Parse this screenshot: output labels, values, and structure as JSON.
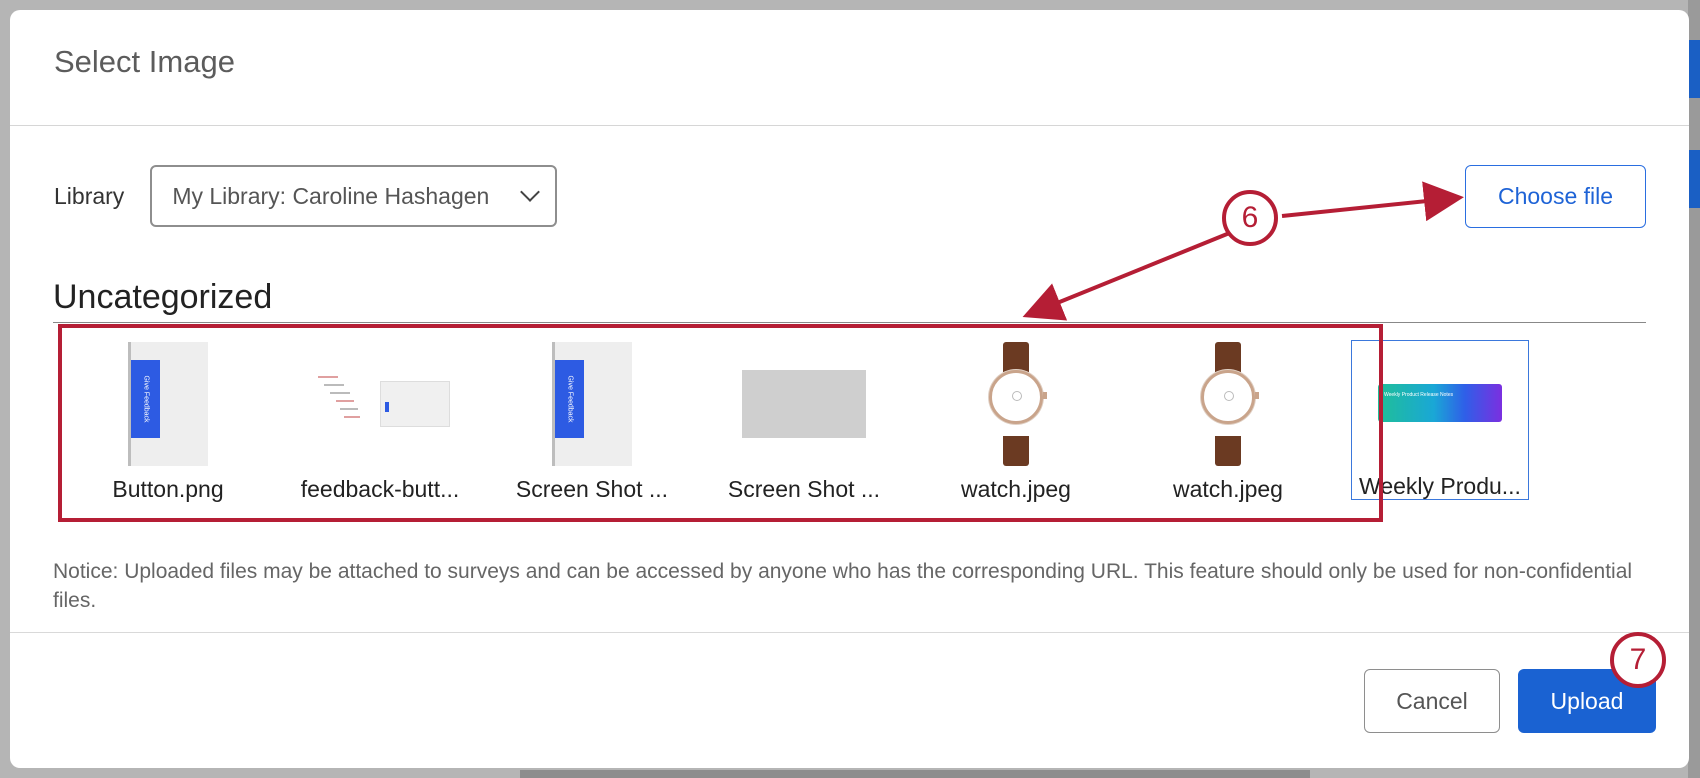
{
  "dialog": {
    "title": "Select Image"
  },
  "library": {
    "label": "Library",
    "selected": "My Library: Caroline Hashagen"
  },
  "choose_file_label": "Choose file",
  "section": {
    "title": "Uncategorized"
  },
  "files": [
    {
      "name": "Button.png",
      "thumb": "feedback-tab-icon"
    },
    {
      "name": "feedback-butt...",
      "thumb": "screenshot-icon"
    },
    {
      "name": "Screen Shot ...",
      "thumb": "feedback-tab-icon"
    },
    {
      "name": "Screen Shot ...",
      "thumb": "gray-placeholder-icon"
    },
    {
      "name": "watch.jpeg",
      "thumb": "watch-icon"
    },
    {
      "name": "watch.jpeg",
      "thumb": "watch-icon"
    },
    {
      "name": "Weekly Produ...",
      "thumb": "banner-icon",
      "selected": true
    }
  ],
  "thumb_text": {
    "feedback_tab": "Give Feedback",
    "banner": "Weekly Product Release Notes"
  },
  "notice": "Notice: Uploaded files may be attached to surveys and can be accessed by anyone who has the corresponding URL. This feature should only be used for non-confidential files.",
  "footer": {
    "cancel_label": "Cancel",
    "upload_label": "Upload"
  },
  "callouts": {
    "step_a": "6",
    "step_b": "7"
  },
  "colors": {
    "accent": "#1a62d2",
    "annotation": "#b51e35"
  }
}
